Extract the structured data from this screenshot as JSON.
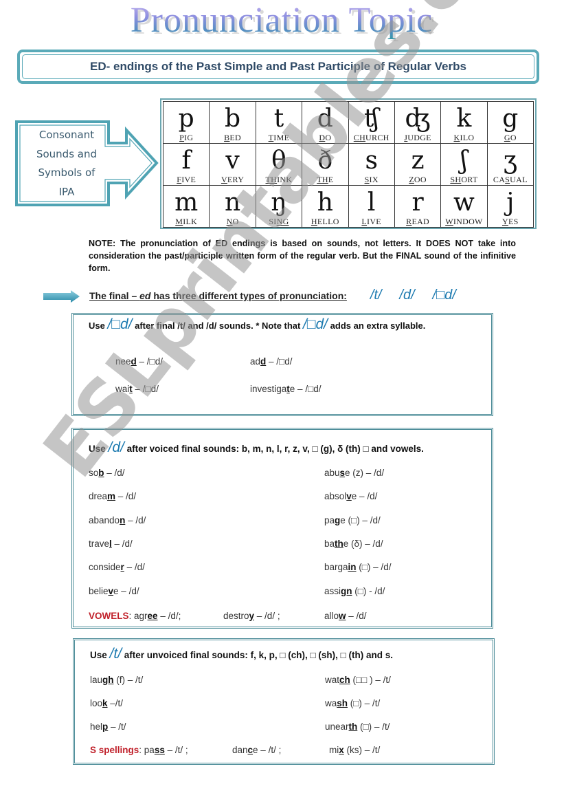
{
  "title": "Pronunciation Topic",
  "subtitle": "ED- endings of the Past Simple and Past Participle of Regular Verbs",
  "callout": {
    "lines": [
      "Consonant",
      "Sounds and",
      "Symbols of",
      "IPA"
    ],
    "icon": "right-arrow-icon"
  },
  "ipa_table": {
    "rows": [
      [
        {
          "symbol": "p",
          "pre": "",
          "u": "P",
          "post": "IG"
        },
        {
          "symbol": "b",
          "pre": "",
          "u": "B",
          "post": "ED"
        },
        {
          "symbol": "t",
          "pre": "",
          "u": "T",
          "post": "IME"
        },
        {
          "symbol": "d",
          "pre": "",
          "u": "D",
          "post": "O"
        },
        {
          "symbol": "ʧ",
          "pre": "",
          "u": "CH",
          "post": "URCH"
        },
        {
          "symbol": "ʤ",
          "pre": "",
          "u": "J",
          "post": "UDGE"
        },
        {
          "symbol": "k",
          "pre": "",
          "u": "K",
          "post": "ILO"
        },
        {
          "symbol": "g",
          "pre": "",
          "u": "G",
          "post": "O"
        }
      ],
      [
        {
          "symbol": "f",
          "pre": "",
          "u": "F",
          "post": "IVE"
        },
        {
          "symbol": "v",
          "pre": "",
          "u": "V",
          "post": "ERY"
        },
        {
          "symbol": "θ",
          "pre": "",
          "u": "TH",
          "post": "INK"
        },
        {
          "symbol": "ð",
          "pre": "",
          "u": "TH",
          "post": "E"
        },
        {
          "symbol": "s",
          "pre": "",
          "u": "S",
          "post": "IX"
        },
        {
          "symbol": "z",
          "pre": "",
          "u": "Z",
          "post": "OO"
        },
        {
          "symbol": "ʃ",
          "pre": "",
          "u": "SH",
          "post": "ORT"
        },
        {
          "symbol": "ʒ",
          "pre": "CA",
          "u": "S",
          "post": "UAL"
        }
      ],
      [
        {
          "symbol": "m",
          "pre": "",
          "u": "M",
          "post": "ILK"
        },
        {
          "symbol": "n",
          "pre": "",
          "u": "N",
          "post": "O"
        },
        {
          "symbol": "ŋ",
          "pre": "SI",
          "u": "NG",
          "post": ""
        },
        {
          "symbol": "h",
          "pre": "",
          "u": "H",
          "post": "ELLO"
        },
        {
          "symbol": "l",
          "pre": "",
          "u": "L",
          "post": "IVE"
        },
        {
          "symbol": "r",
          "pre": "",
          "u": "R",
          "post": "EAD"
        },
        {
          "symbol": "w",
          "pre": "",
          "u": "W",
          "post": "INDOW"
        },
        {
          "symbol": "j",
          "pre": "",
          "u": "Y",
          "post": "ES"
        }
      ]
    ]
  },
  "note": "NOTE: The pronunciation of ED endings is based on sounds, not letters. It DOES NOT take into consideration the past/participle written form of the regular verb. But the FINAL sound of the infinitive form.",
  "final_line": {
    "text": "The final – ed  has three different types of pronunciation:",
    "text_pre": "The final – ",
    "text_em": "ed",
    "text_post": "  has three different types of pronunciation:",
    "sounds": [
      "/t/",
      "/d/",
      "/□d/"
    ]
  },
  "box_id": {
    "head_pre": "Use ",
    "head_sound": "/□d/",
    "head_mid": " after final /t/ and /d/ sounds. * Note that ",
    "head_sound2": "/□d/",
    "head_post": " adds an extra syllable.",
    "items": [
      {
        "pre": "nee",
        "u": "d",
        "post": " – /□d/"
      },
      {
        "pre": "ad",
        "u": "d",
        "post": " – /□d/"
      },
      {
        "pre": "wai",
        "u": "t",
        "post": " – /□d/"
      },
      {
        "pre": "investiga",
        "u": "t",
        "post": "e – /□d/"
      }
    ]
  },
  "box_d": {
    "head_pre": "Use ",
    "head_sound": "/d/",
    "head_post": " after voiced final sounds: b, m, n, l, r, z, v, □ (g), δ (th) □ and vowels.",
    "left": [
      {
        "pre": "so",
        "u": "b",
        "post": " – /d/"
      },
      {
        "pre": "drea",
        "u": "m",
        "post": " – /d/"
      },
      {
        "pre": "abando",
        "u": "n",
        "post": " – /d/"
      },
      {
        "pre": "trave",
        "u": "l",
        "post": " – /d/"
      },
      {
        "pre": "conside",
        "u": "r",
        "post": " – /d/"
      },
      {
        "pre": "belie",
        "u": "v",
        "post": "e – /d/"
      }
    ],
    "right": [
      {
        "pre": "abu",
        "u": "s",
        "post": "e (z) – /d/"
      },
      {
        "pre": "absol",
        "u": "v",
        "post": "e – /d/"
      },
      {
        "pre": "pa",
        "u": "g",
        "post": "e (□) – /d/"
      },
      {
        "pre": "ba",
        "u": "th",
        "post": "e (δ) – /d/"
      },
      {
        "pre": "barga",
        "u": "in",
        "post": " (□) – /d/"
      },
      {
        "pre": "assi",
        "u": "gn",
        "post": " (□) - /d/"
      }
    ],
    "vowels_label": "VOWELS",
    "vowels": [
      {
        "pre": ": agr",
        "u": "ee",
        "post": " – /d/;"
      },
      {
        "pre": "destro",
        "u": "y",
        "post": " – /d/ ;"
      },
      {
        "pre": "allo",
        "u": "w",
        "post": " – /d/"
      }
    ]
  },
  "box_t": {
    "head_pre": "Use ",
    "head_sound": "/t/",
    "head_post": " after unvoiced final sounds: f, k, p, □ (ch), □ (sh), □ (th) and s.",
    "left": [
      {
        "pre": "lau",
        "u": "gh",
        "post": " (f) – /t/"
      },
      {
        "pre": "loo",
        "u": "k",
        "post": " –/t/"
      },
      {
        "pre": "hel",
        "u": "p",
        "post": " – /t/"
      }
    ],
    "right": [
      {
        "pre": "wat",
        "u": "ch",
        "post": " (□□ ) – /t/"
      },
      {
        "pre": "wa",
        "u": "sh",
        "post": " (□) –  /t/"
      },
      {
        "pre": "unear",
        "u": "th",
        "post": "  (□)  – /t/"
      }
    ],
    "s_label": "S spellings",
    "s_items": [
      {
        "pre": ": pa",
        "u": "ss",
        "post": " – /t/   ;"
      },
      {
        "pre": "dan",
        "u": "c",
        "post": "e – /t/  ;"
      },
      {
        "pre": "mi",
        "u": "x",
        "post": " (ks) – /t/"
      }
    ]
  },
  "watermark": "ESLprintables.com",
  "colors": {
    "accent_teal": "#5aaab8",
    "ipa_blue": "#1c7ab0",
    "heading_navy": "#2f4a66",
    "label_red": "#c0202a"
  }
}
